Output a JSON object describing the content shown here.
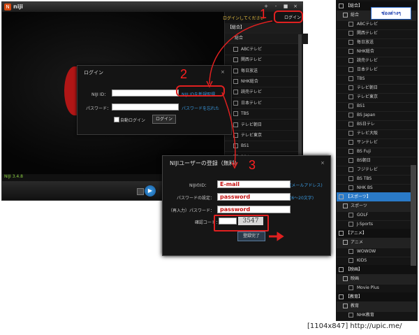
{
  "app": {
    "logo": "N",
    "name": "niji",
    "version": "NIJI 3.4.8"
  },
  "window_controls": [
    "+",
    "-",
    "■",
    "×"
  ],
  "header": {
    "login_prompt": "ログインしてください",
    "login_button": "ログイン"
  },
  "channels": [
    {
      "label": "【総合】",
      "kind": "cat"
    },
    {
      "label": "総合",
      "kind": "sub"
    },
    {
      "label": "ABCテレビ",
      "kind": "item"
    },
    {
      "label": "関西テレビ",
      "kind": "item"
    },
    {
      "label": "毎日放送",
      "kind": "item"
    },
    {
      "label": "NHK総合",
      "kind": "item"
    },
    {
      "label": "読売テレビ",
      "kind": "item"
    },
    {
      "label": "日本テレビ",
      "kind": "item"
    },
    {
      "label": "TBS",
      "kind": "item"
    },
    {
      "label": "テレビ朝日",
      "kind": "item"
    },
    {
      "label": "テレビ東京",
      "kind": "item"
    },
    {
      "label": "BS1",
      "kind": "item"
    },
    {
      "label": "BS Japan",
      "kind": "item"
    },
    {
      "label": "BS日テレ",
      "kind": "item"
    },
    {
      "label": "テレビ大阪",
      "kind": "item"
    }
  ],
  "login_dialog": {
    "title": "ログイン",
    "id_label": "NIJI ID：",
    "register_link": "NIJI IDを新規取得",
    "password_label": "パスワード：",
    "forgot_link": "パスワードを忘れた",
    "auto_login": "自動ログイン",
    "submit": "ログイン"
  },
  "register_dialog": {
    "title": "NIJIユーザーの登録（無料）",
    "id_label": "NIJIのID：",
    "id_value": "E-mail",
    "id_hint": "(メールアドレス)",
    "password_label": "パスワードの設定：",
    "password_value": "password",
    "password_hint": "(6～20文字)",
    "confirm_label": "（再入力）パスワード：",
    "confirm_value": "password",
    "captcha_label": "確認コード：",
    "captcha_value": "3547",
    "submit": "登録完了"
  },
  "annotations": {
    "step1": "1",
    "step2": "2",
    "step3": "3",
    "thai_tag": "ช่องต่างๆ"
  },
  "side_list": [
    {
      "label": "【総合】",
      "kind": "cat"
    },
    {
      "label": "総合",
      "kind": "sub"
    },
    {
      "label": "ABCテレビ",
      "kind": "item"
    },
    {
      "label": "関西テレビ",
      "kind": "item"
    },
    {
      "label": "毎日放送",
      "kind": "item"
    },
    {
      "label": "NHK総合",
      "kind": "item"
    },
    {
      "label": "読売テレビ",
      "kind": "item"
    },
    {
      "label": "日本テレビ",
      "kind": "item"
    },
    {
      "label": "TBS",
      "kind": "item"
    },
    {
      "label": "テレビ朝日",
      "kind": "item"
    },
    {
      "label": "テレビ東京",
      "kind": "item"
    },
    {
      "label": "BS1",
      "kind": "item"
    },
    {
      "label": "BS Japan",
      "kind": "item"
    },
    {
      "label": "BS日テレ",
      "kind": "item"
    },
    {
      "label": "テレビ大阪",
      "kind": "item"
    },
    {
      "label": "サンテレビ",
      "kind": "item"
    },
    {
      "label": "BS Fuji",
      "kind": "item"
    },
    {
      "label": "BS朝日",
      "kind": "item"
    },
    {
      "label": "フジテレビ",
      "kind": "item"
    },
    {
      "label": "BS TBS",
      "kind": "item"
    },
    {
      "label": "NHK BS",
      "kind": "item"
    },
    {
      "label": "【スポーツ】",
      "kind": "sel"
    },
    {
      "label": "スポーツ",
      "kind": "sub"
    },
    {
      "label": "GOLF",
      "kind": "item"
    },
    {
      "label": "J-Sports",
      "kind": "item"
    },
    {
      "label": "【アニメ】",
      "kind": "cat"
    },
    {
      "label": "アニメ",
      "kind": "sub"
    },
    {
      "label": "WOWOW",
      "kind": "item"
    },
    {
      "label": "KIDS",
      "kind": "item"
    },
    {
      "label": "【映画】",
      "kind": "cat"
    },
    {
      "label": "映画",
      "kind": "sub"
    },
    {
      "label": "Movie Plus",
      "kind": "item"
    },
    {
      "label": "【教育】",
      "kind": "cat"
    },
    {
      "label": "教育",
      "kind": "sub"
    },
    {
      "label": "NHK教育",
      "kind": "item"
    }
  ],
  "footer": "[1104x847] http://upic.me/",
  "colors": {
    "accent_red": "#e02020",
    "link_blue": "#3a9ae0",
    "selected": "#2a7ac8"
  }
}
